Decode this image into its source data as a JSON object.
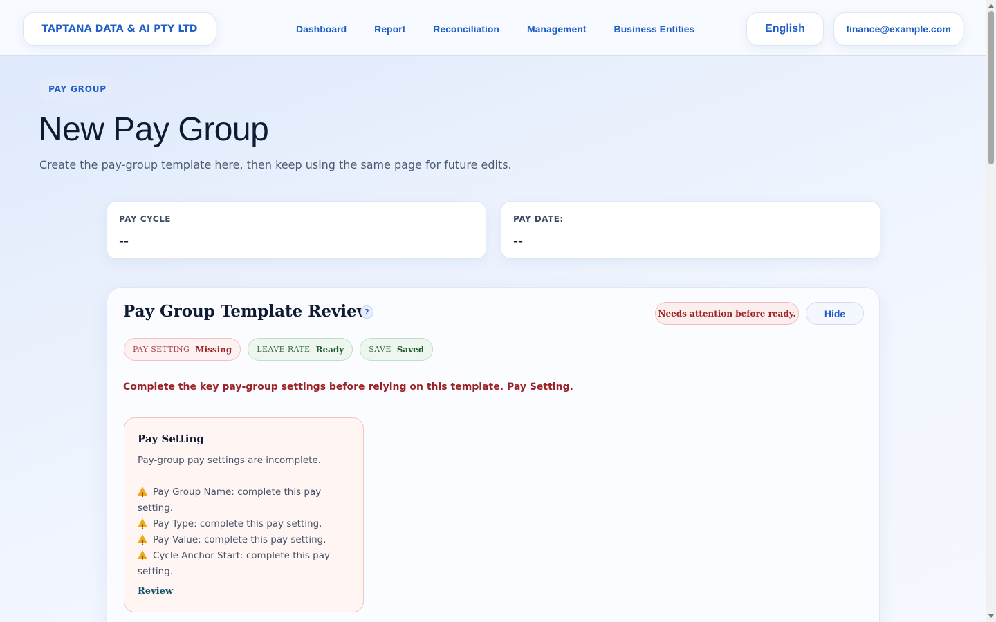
{
  "topbar": {
    "brand": "TAPTANA DATA & AI PTY LTD",
    "nav": [
      "Dashboard",
      "Report",
      "Reconciliation",
      "Management",
      "Business Entities"
    ],
    "language": "English",
    "user_email": "finance@example.com"
  },
  "header": {
    "eyebrow": "PAY GROUP",
    "title": "New Pay Group",
    "subtitle": "Create the pay-group template here, then keep using the same page for future edits."
  },
  "summary": {
    "pay_cycle_label": "PAY CYCLE",
    "pay_cycle_value": "--",
    "pay_date_label": "PAY DATE:",
    "pay_date_value": "--"
  },
  "review": {
    "title": "Pay Group Template Review",
    "help_glyph": "?",
    "status_badge": "Needs attention before ready.",
    "hide_label": "Hide",
    "chips": [
      {
        "key": "PAY SETTING",
        "value": "Missing",
        "state": "missing"
      },
      {
        "key": "LEAVE RATE",
        "value": "Ready",
        "state": "ok"
      },
      {
        "key": "SAVE",
        "value": "Saved",
        "state": "ok"
      }
    ],
    "warning": "Complete the key pay-group settings before relying on this template. Pay Setting.",
    "issue": {
      "title": "Pay Setting",
      "description": "Pay-group pay settings are incomplete.",
      "items": [
        "Pay Group Name: complete this pay setting.",
        "Pay Type: complete this pay setting.",
        "Pay Value: complete this pay setting.",
        "Cycle Anchor Start: complete this pay setting."
      ],
      "action": "Review"
    }
  },
  "colors": {
    "accent": "#1f5fc6",
    "danger": "#9b2226",
    "success": "#1d5e2c",
    "warning_icon": "#f2a81d"
  }
}
